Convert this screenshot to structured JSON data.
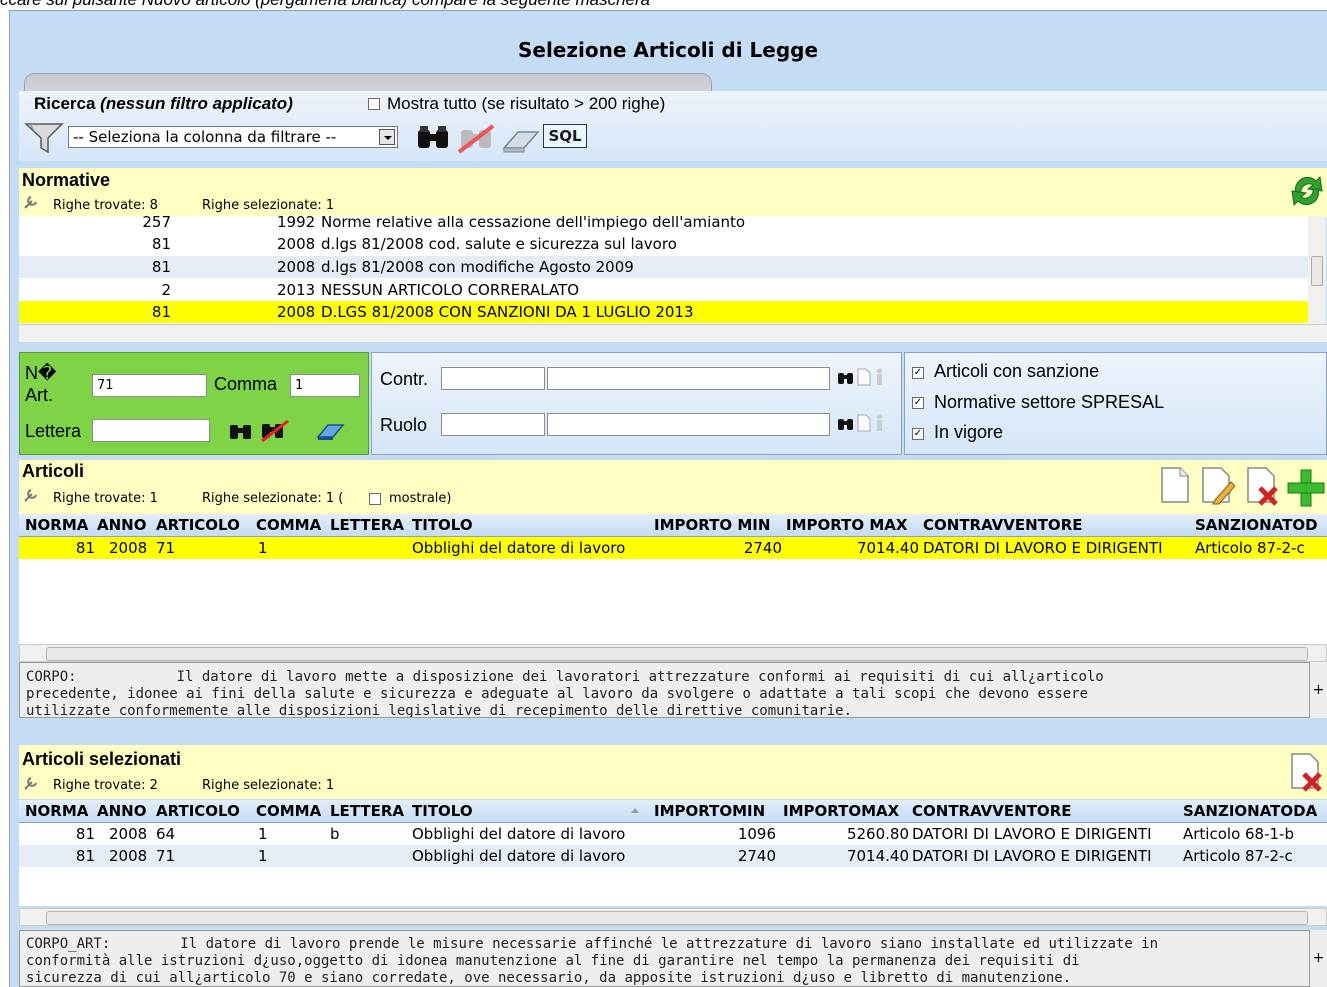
{
  "caption": "ccare sul pulsante Nuovo articolo (pergamena bianca) compare la seguente maschera",
  "window_title": "Selezione Articoli di Legge",
  "search": {
    "label": "Ricerca",
    "filter_status": "(nessun filtro applicato)",
    "show_all_label": "Mostra tutto (se risultato > 200 righe)",
    "column_select": "-- Seleziona la colonna da filtrare --",
    "sql_label": "SQL"
  },
  "normative": {
    "title": "Normative",
    "found_label": "Righe trovate: 8",
    "selected_label": "Righe selezionate: 1",
    "rows": [
      {
        "num": "257",
        "year": "1992",
        "desc": "Norme relative alla cessazione dell'impiego dell'amianto"
      },
      {
        "num": "81",
        "year": "2008",
        "desc": "d.lgs 81/2008 cod. salute e sicurezza sul lavoro"
      },
      {
        "num": "81",
        "year": "2008",
        "desc": "d.lgs 81/2008 con modifiche Agosto 2009"
      },
      {
        "num": "2",
        "year": "2013",
        "desc": "NESSUN ARTICOLO CORRERALATO"
      },
      {
        "num": "81",
        "year": "2008",
        "desc": "D.LGS 81/2008 CON SANZIONI DA 1 LUGLIO 2013"
      }
    ]
  },
  "filters": {
    "num_art_label": "N� Art.",
    "num_art_value": "71",
    "comma_label": "Comma",
    "comma_value": "1",
    "lettera_label": "Lettera",
    "lettera_value": "",
    "contr_label": "Contr.",
    "ruolo_label": "Ruolo",
    "check1": "Articoli con sanzione",
    "check2": "Normative settore SPRESAL",
    "check3": "In vigore"
  },
  "articoli": {
    "title": "Articoli",
    "found_label": "Righe trovate: 1",
    "selected_label": "Righe selezionate: 1 (",
    "show_label": "mostrale)",
    "columns": [
      "NORMA",
      "ANNO",
      "ARTICOLO",
      "COMMA",
      "LETTERA",
      "TITOLO",
      "IMPORTO MIN",
      "IMPORTO MAX",
      "CONTRAVVENTORE",
      "SANZIONATOD"
    ],
    "rows": [
      {
        "norma": "81",
        "anno": "2008",
        "articolo": "71",
        "comma": "1",
        "lettera": "",
        "titolo": "Obblighi del datore di lavoro",
        "min": "2740",
        "max": "7014.40",
        "contr": "DATORI DI LAVORO E DIRIGENTI",
        "sanz": "Articolo 87-2-c"
      }
    ],
    "corpo_label": "CORPO:",
    "corpo_line1": "Il datore di lavoro mette a disposizione dei lavoratori attrezzature conformi ai requisiti di cui all¿articolo",
    "corpo_line2": "precedente, idonee ai fini della salute e sicurezza e adeguate al lavoro da svolgere o adattate a tali scopi che devono essere",
    "corpo_line3": "utilizzate conformemente alle disposizioni legislative di recepimento delle direttive comunitarie."
  },
  "selezionati": {
    "title": "Articoli selezionati",
    "found_label": "Righe trovate: 2",
    "selected_label": "Righe selezionate: 1",
    "columns": [
      "NORMA",
      "ANNO",
      "ARTICOLO",
      "COMMA",
      "LETTERA",
      "TITOLO",
      "IMPORTOMIN",
      "IMPORTOMAX",
      "CONTRAVVENTORE",
      "SANZIONATODA"
    ],
    "rows": [
      {
        "norma": "81",
        "anno": "2008",
        "articolo": "64",
        "comma": "1",
        "lettera": "b",
        "titolo": "Obblighi del datore di lavoro",
        "min": "1096",
        "max": "5260.80",
        "contr": "DATORI DI LAVORO E DIRIGENTI",
        "sanz": "Articolo 68-1-b"
      },
      {
        "norma": "81",
        "anno": "2008",
        "articolo": "71",
        "comma": "1",
        "lettera": "",
        "titolo": "Obblighi del datore di lavoro",
        "min": "2740",
        "max": "7014.40",
        "contr": "DATORI DI LAVORO E DIRIGENTI",
        "sanz": "Articolo 87-2-c"
      }
    ],
    "corpo_label": "CORPO_ART:",
    "corpo_line1": "Il datore di lavoro prende le misure necessarie affinché le attrezzature di lavoro siano installate ed utilizzate in",
    "corpo_line2": "conformità alle istruzioni d¿uso,oggetto di idonea manutenzione al fine di garantire nel tempo la permanenza dei requisiti di",
    "corpo_line3": "sicurezza di cui all¿articolo 70 e siano corredate, ove necessario, da apposite istruzioni d¿uso e libretto di manutenzione."
  },
  "colors": {
    "selected_row": "#ffff00",
    "panel_header": "#ffffc4",
    "filter_green": "#7fd347",
    "grid_header": "#c5dcf5"
  }
}
